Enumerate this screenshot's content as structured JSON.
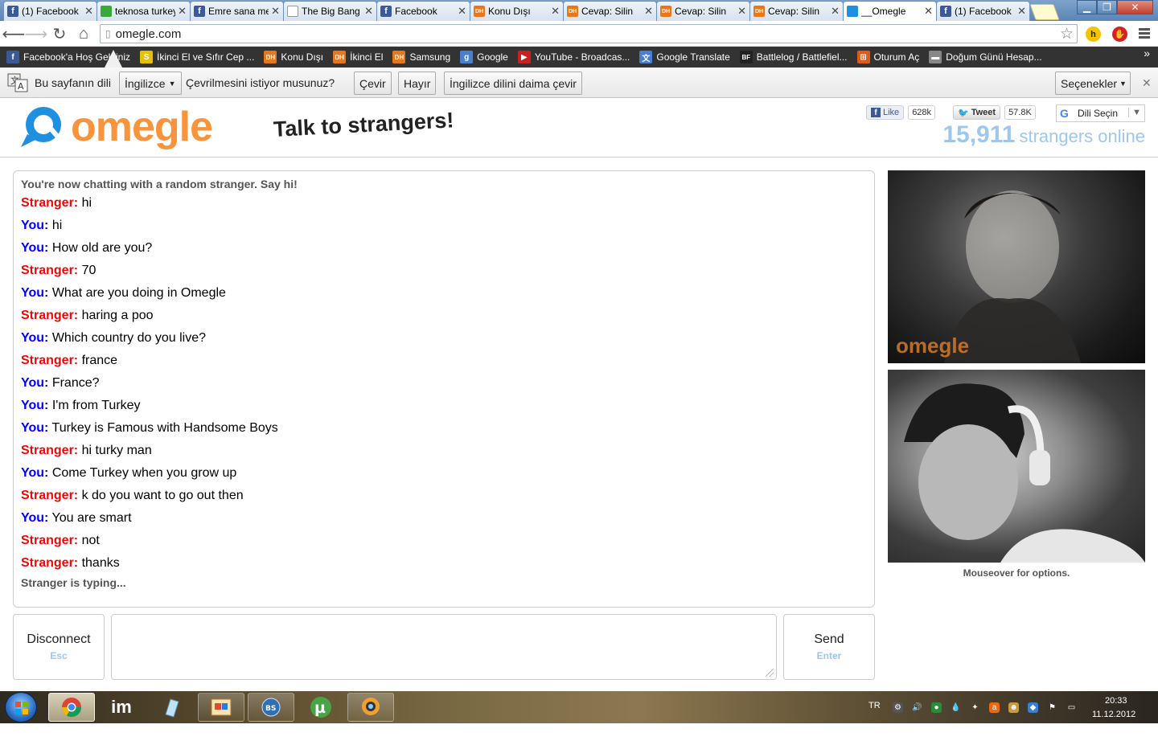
{
  "browser": {
    "tabs": [
      {
        "title": "(1) Facebook",
        "icon": "facebook-icon",
        "color": "#3b5998",
        "glyph": "f",
        "active": false
      },
      {
        "title": "teknosa turkey",
        "icon": "teknosa-icon",
        "color": "#3aa83a",
        "glyph": "",
        "active": false
      },
      {
        "title": "Emre sana mesaj",
        "icon": "facebook-icon",
        "color": "#3b5998",
        "glyph": "f",
        "active": false
      },
      {
        "title": "The Big Bang",
        "icon": "page-icon",
        "color": "#ffffff",
        "glyph": "",
        "active": false
      },
      {
        "title": "Facebook",
        "icon": "facebook-icon",
        "color": "#3b5998",
        "glyph": "f",
        "active": false
      },
      {
        "title": "Konu Dışı",
        "icon": "dh-icon",
        "color": "#e8761a",
        "glyph": "DH",
        "active": false
      },
      {
        "title": "Cevap: Silin",
        "icon": "dh-icon",
        "color": "#e8761a",
        "glyph": "DH",
        "active": false
      },
      {
        "title": "Cevap: Silin",
        "icon": "dh-icon",
        "color": "#e8761a",
        "glyph": "DH",
        "active": false
      },
      {
        "title": "Cevap: Silin",
        "icon": "dh-icon",
        "color": "#e8761a",
        "glyph": "DH",
        "active": false
      },
      {
        "title": "__Omegle",
        "icon": "omegle-icon",
        "color": "#1f8fdf",
        "glyph": "",
        "active": true
      },
      {
        "title": "(1) Facebook",
        "icon": "facebook-icon",
        "color": "#3b5998",
        "glyph": "f",
        "active": false
      }
    ],
    "url": "omegle.com",
    "bookmarks": [
      {
        "label": "Facebook'a Hoş Geldiniz",
        "icon": "facebook-icon",
        "color": "#3b5998",
        "glyph": "f"
      },
      {
        "label": "İkinci El ve Sıfır Cep ...",
        "icon": "sahibinden-icon",
        "color": "#e6c100",
        "glyph": "S"
      },
      {
        "label": "Konu Dışı",
        "icon": "dh-icon",
        "color": "#e8761a",
        "glyph": "DH"
      },
      {
        "label": "İkinci El",
        "icon": "dh-icon",
        "color": "#e8761a",
        "glyph": "DH"
      },
      {
        "label": "Samsung",
        "icon": "dh-icon",
        "color": "#e8761a",
        "glyph": "DH"
      },
      {
        "label": "Google",
        "icon": "google-icon",
        "color": "#4a7fd0",
        "glyph": "g"
      },
      {
        "label": "YouTube - Broadcas...",
        "icon": "youtube-icon",
        "color": "#cc1f1f",
        "glyph": "▶"
      },
      {
        "label": "Google Translate",
        "icon": "translate-icon",
        "color": "#4a7fd0",
        "glyph": "文"
      },
      {
        "label": "Battlelog / Battlefiel...",
        "icon": "battlelog-icon",
        "color": "#222222",
        "glyph": "BF"
      },
      {
        "label": "Oturum Aç",
        "icon": "windows-icon",
        "color": "#e05a1a",
        "glyph": "⊞"
      },
      {
        "label": "Doğum Günü Hesap...",
        "icon": "page-icon",
        "color": "#888888",
        "glyph": "▬"
      }
    ]
  },
  "translate_bar": {
    "prefix": "Bu sayfanın dili",
    "language": "İngilizce",
    "question": "Çevrilmesini istiyor musunuz?",
    "translate_button": "Çevir",
    "no_button": "Hayır",
    "always_button": "İngilizce dilini daima çevir",
    "options_button": "Seçenekler"
  },
  "omegle": {
    "logo_text": "omegle",
    "tagline": "Talk to strangers!",
    "fb_like": "Like",
    "fb_count": "628k",
    "tweet": "Tweet",
    "tweet_count": "57.8K",
    "language_select": "Dili Seçin",
    "online_count": "15,911",
    "online_label": "strangers online",
    "status_message": "You're now chatting with a random stranger. Say hi!",
    "messages": [
      {
        "who": "Stranger:",
        "text": "hi"
      },
      {
        "who": "You:",
        "text": "hi"
      },
      {
        "who": "You:",
        "text": "How old are you?"
      },
      {
        "who": "Stranger:",
        "text": "70"
      },
      {
        "who": "You:",
        "text": "What are you doing in Omegle"
      },
      {
        "who": "Stranger:",
        "text": "haring a poo"
      },
      {
        "who": "You:",
        "text": "Which country do you live?"
      },
      {
        "who": "Stranger:",
        "text": "france"
      },
      {
        "who": "You:",
        "text": "France?"
      },
      {
        "who": "You:",
        "text": "I'm from Turkey"
      },
      {
        "who": "You:",
        "text": "Turkey is Famous with Handsome Boys"
      },
      {
        "who": "Stranger:",
        "text": "hi turky man"
      },
      {
        "who": "You:",
        "text": "Come Turkey when you grow up"
      },
      {
        "who": "Stranger:",
        "text": "k do you want to go out then"
      },
      {
        "who": "You:",
        "text": "You are smart"
      },
      {
        "who": "Stranger:",
        "text": "not"
      },
      {
        "who": "Stranger:",
        "text": "thanks"
      }
    ],
    "typing_status": "Stranger is typing...",
    "video_watermark": "omegle",
    "mouseover_hint": "Mouseover for options.",
    "disconnect_label": "Disconnect",
    "disconnect_key": "Esc",
    "send_label": "Send",
    "send_key": "Enter",
    "colors": {
      "stranger": "#ff0000",
      "you": "#0000ff",
      "brand_orange": "#f7943c",
      "brand_blue": "#1f8fdf",
      "online": "#9fc7ee"
    }
  },
  "taskbar": {
    "apps": [
      "chrome-icon",
      "im-icon",
      "notepad-icon",
      "paint-icon",
      "bs-player-icon",
      "utorrent-icon",
      "webcam-icon"
    ],
    "im_label": "im",
    "language": "TR",
    "time": "20:33",
    "date": "11.12.2012"
  }
}
